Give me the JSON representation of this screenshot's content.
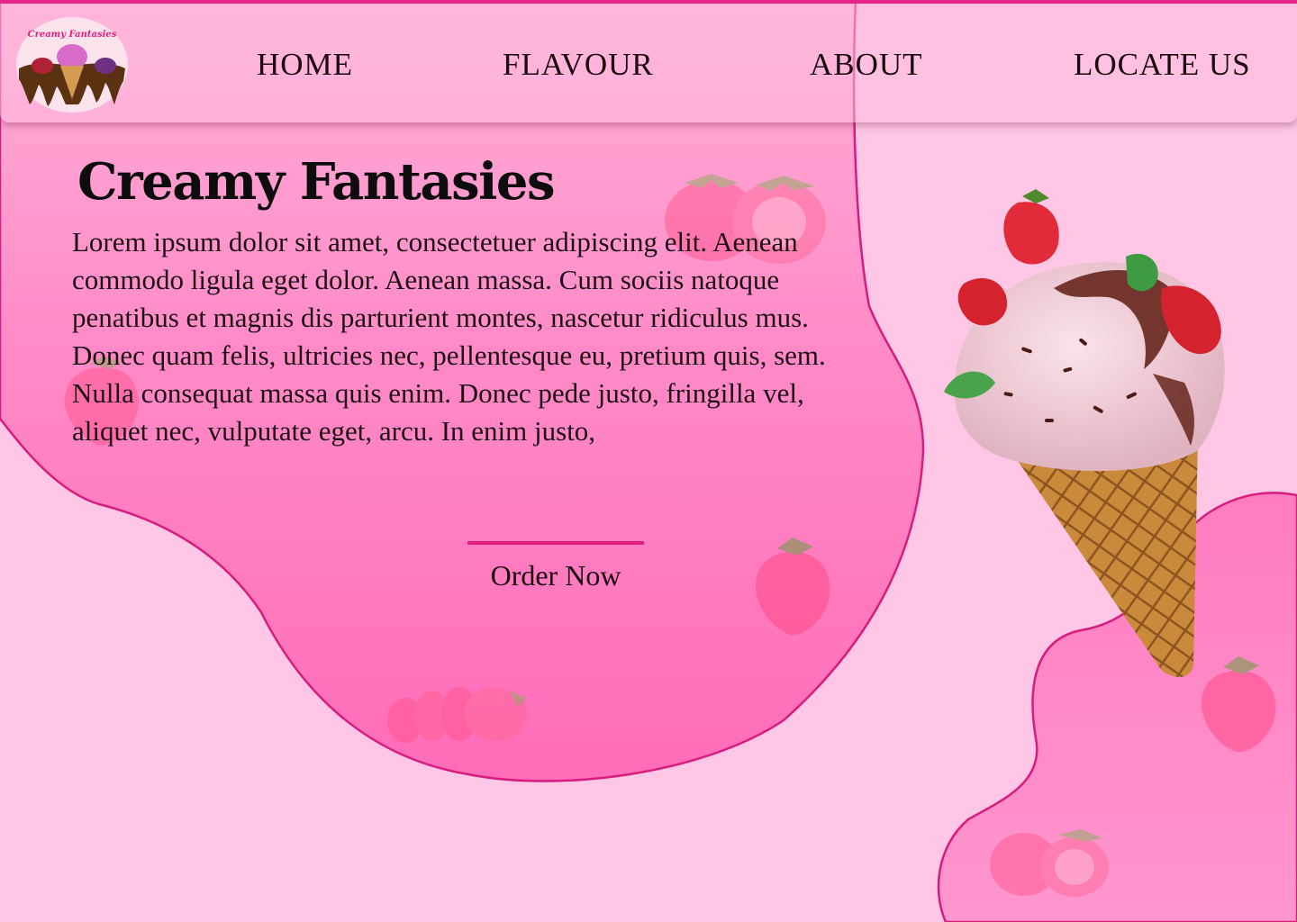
{
  "brand": {
    "logo_text": "Creamy Fantasies"
  },
  "nav": {
    "items": [
      {
        "label": "HOME"
      },
      {
        "label": "FLAVOUR"
      },
      {
        "label": "ABOUT"
      },
      {
        "label": "LOCATE US"
      }
    ]
  },
  "hero": {
    "title": "Creamy Fantasies",
    "body": "Lorem ipsum dolor sit amet, consectetuer adipiscing elit. Aenean commodo ligula eget dolor. Aenean massa. Cum sociis natoque penatibus et magnis dis parturient montes, nascetur ridiculus mus. Donec quam felis, ultricies nec, pellentesque eu, pretium quis, sem. Nulla consequat massa quis enim. Donec pede justo, fringilla vel, aliquet nec, vulputate eget, arcu. In enim justo,",
    "cta_label": "Order Now"
  },
  "images": {
    "hero_image": "ice-cream-cone-icon",
    "decorations": "strawberry-icon"
  },
  "colors": {
    "background": "#ffc6e6",
    "blob": "#ff7ec0",
    "accent": "#e01f84",
    "text": "#1a0a10"
  }
}
